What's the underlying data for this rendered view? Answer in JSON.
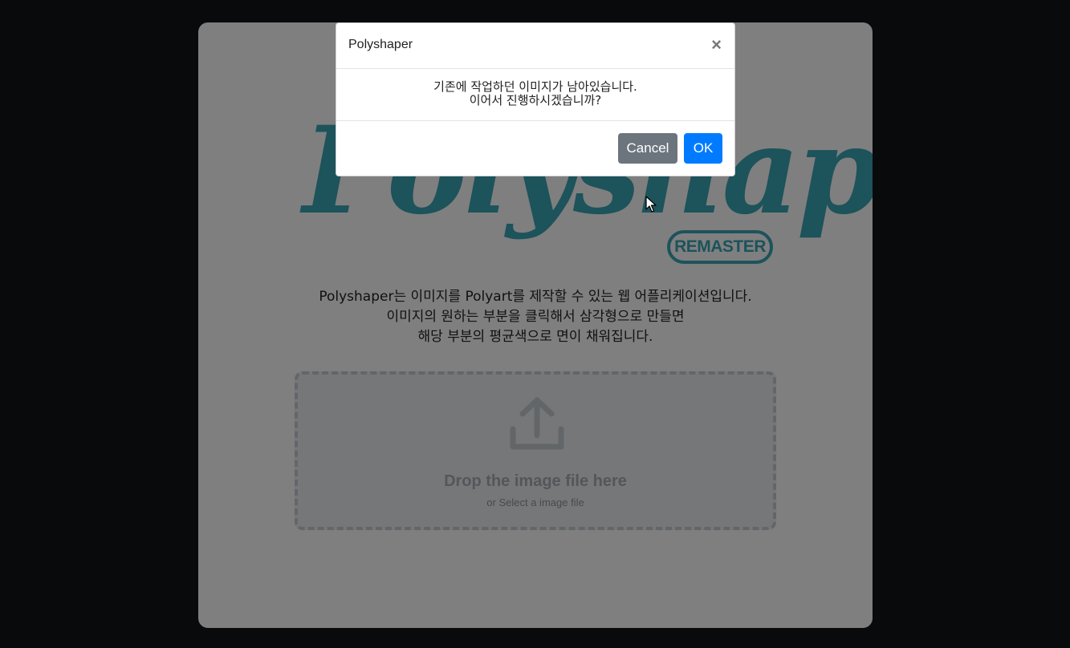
{
  "app": {
    "logo_text": "Polyshaper",
    "badge": "REMASTER",
    "description": [
      "Polyshaper는 이미지를 Polyart를 제작할 수 있는 웹 어플리케이션입니다.",
      "이미지의 원하는 부분을 클릭해서 삼각형으로 만들면",
      "해당 부분의 평균색으로 면이 채워집니다."
    ],
    "dropzone": {
      "icon": "upload-icon",
      "title": "Drop the image file here",
      "subtitle": "or Select a image file"
    }
  },
  "modal": {
    "title": "Polyshaper",
    "close_icon": "close-icon",
    "message": [
      "기존에 작업하던 이미지가 남아있습니다.",
      "이어서 진행하시겠습니까?"
    ],
    "cancel_label": "Cancel",
    "ok_label": "OK"
  },
  "colors": {
    "brand": "#3aa6b6",
    "cancel": "#6c757d",
    "ok": "#007bff"
  }
}
